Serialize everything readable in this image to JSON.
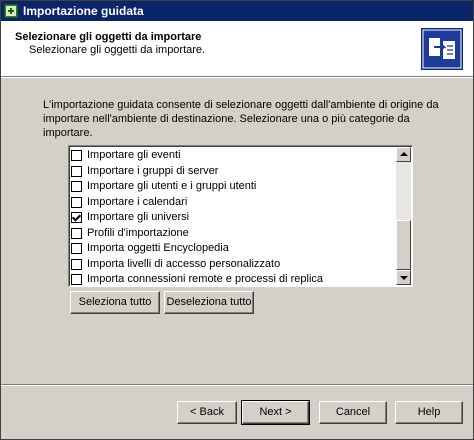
{
  "window": {
    "title": "Importazione guidata"
  },
  "header": {
    "title": "Selezionare gli oggetti da importare",
    "subtitle": "Selezionare gli oggetti da importare.",
    "icon": "import-wizard-icon"
  },
  "description": "L'importazione guidata consente di selezionare oggetti dall'ambiente di origine da importare nell'ambiente di destinazione. Selezionare una o più categorie da importare.",
  "categories": [
    {
      "label": "Importare gli eventi",
      "checked": false
    },
    {
      "label": "Importare i gruppi di server",
      "checked": false
    },
    {
      "label": "Importare gli utenti e i gruppi utenti",
      "checked": false
    },
    {
      "label": "Importare i calendari",
      "checked": false
    },
    {
      "label": "Importare gli universi",
      "checked": true
    },
    {
      "label": "Profili d'importazione",
      "checked": false
    },
    {
      "label": "Importa oggetti Encyclopedia",
      "checked": false
    },
    {
      "label": "Importa livelli di accesso personalizzato",
      "checked": false
    },
    {
      "label": "Importa connessioni remote e processi di replica",
      "checked": false
    }
  ],
  "selection_buttons": {
    "select_all": "Seleziona tutto",
    "deselect_all": "Deseleziona tutto"
  },
  "footer": {
    "back": "< Back",
    "next": "Next >",
    "cancel": "Cancel",
    "help": "Help"
  }
}
